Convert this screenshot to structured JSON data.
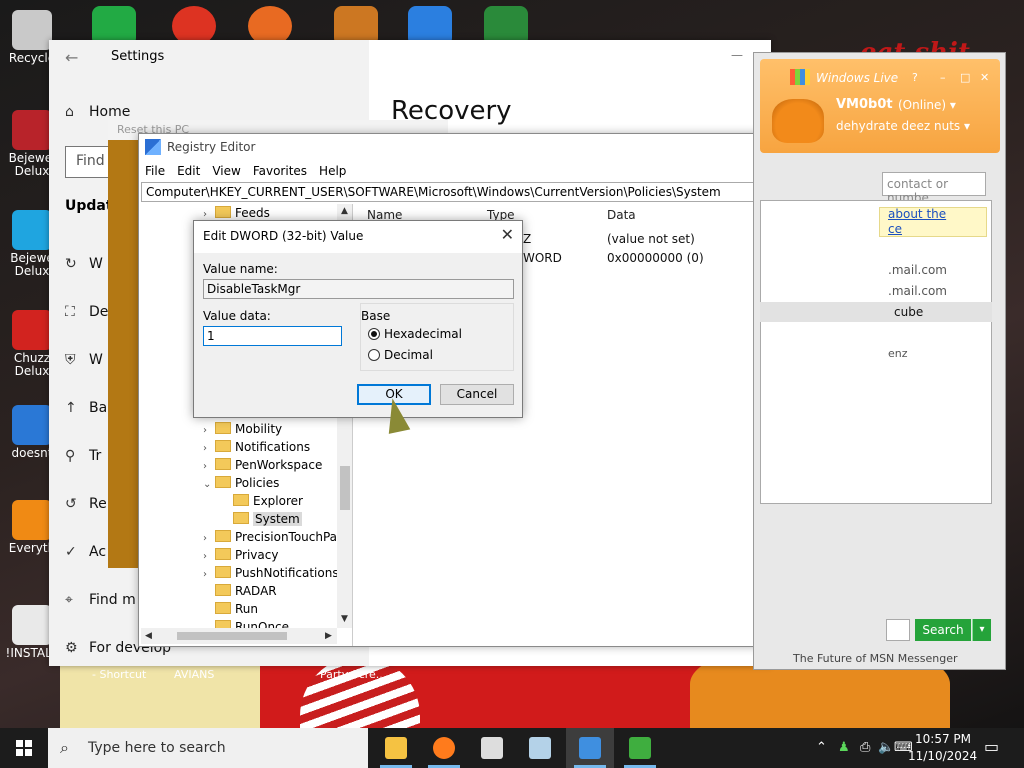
{
  "desktop": {
    "icons": [
      {
        "label": "Recycle",
        "color": "#c9c9c9"
      },
      {
        "label": "Bejewel Delux",
        "color": "#b8232a"
      },
      {
        "label": "Bejewe Delux",
        "color": "#1fa5e0"
      },
      {
        "label": "Chuzz Delux",
        "color": "#d2231f"
      },
      {
        "label": "doesnt",
        "color": "#2a78d6"
      },
      {
        "label": "Everyth",
        "color": "#f08a14"
      },
      {
        "label": "!INSTALL",
        "color": "#e9e9e9"
      }
    ],
    "shortcut_labels": [
      "- Shortcut",
      "AVIANS",
      "Party Scre..."
    ],
    "wallpaper_text": "eat shit"
  },
  "settings": {
    "title": "Settings",
    "back_glyph": "←",
    "min_glyph": "—",
    "nav": [
      {
        "icon": "⌂",
        "label": "Home"
      },
      {
        "icon": "↻",
        "label": "W"
      },
      {
        "icon": "⛶",
        "label": "De"
      },
      {
        "icon": "⛨",
        "label": "W"
      },
      {
        "icon": "↑",
        "label": "Ba"
      },
      {
        "icon": "⚲",
        "label": "Tr"
      },
      {
        "icon": "↺",
        "label": "Re"
      },
      {
        "icon": "✓",
        "label": "Ac"
      },
      {
        "icon": "⌖",
        "label": "Find m"
      },
      {
        "icon": "⚙",
        "label": "For develop"
      }
    ],
    "find_placeholder": "Find",
    "section": "Update",
    "page_title": "Recovery"
  },
  "reset_window": {
    "title": "Reset this PC"
  },
  "regedit": {
    "title": "Registry Editor",
    "menu": [
      "File",
      "Edit",
      "View",
      "Favorites",
      "Help"
    ],
    "address": "Computer\\HKEY_CURRENT_USER\\SOFTWARE\\Microsoft\\Windows\\CurrentVersion\\Policies\\System",
    "tree_top": [
      {
        "label": "Feeds",
        "arrow": "›"
      }
    ],
    "tree": [
      {
        "label": "Mobility",
        "arrow": "›"
      },
      {
        "label": "Notifications",
        "arrow": "›"
      },
      {
        "label": "PenWorkspace",
        "arrow": "›"
      },
      {
        "label": "Policies",
        "arrow": "⌄"
      },
      {
        "label": "Explorer",
        "arrow": ""
      },
      {
        "label": "System",
        "arrow": ""
      },
      {
        "label": "PrecisionTouchPad",
        "arrow": "›"
      },
      {
        "label": "Privacy",
        "arrow": "›"
      },
      {
        "label": "PushNotifications",
        "arrow": "›"
      },
      {
        "label": "RADAR",
        "arrow": ""
      },
      {
        "label": "Run",
        "arrow": ""
      },
      {
        "label": "RunOnce",
        "arrow": ""
      }
    ],
    "columns": [
      "Name",
      "Type",
      "Data"
    ],
    "rows": [
      {
        "type": "Z",
        "data": "(value not set)"
      },
      {
        "type": "WORD",
        "data": "0x00000000 (0)"
      }
    ],
    "scroll_glyphs": {
      "up": "▲",
      "down": "▼",
      "left": "◀",
      "right": "▶"
    }
  },
  "dword_dialog": {
    "title": "Edit DWORD (32-bit) Value",
    "close_glyph": "✕",
    "value_name_label": "Value name:",
    "value_name": "DisableTaskMgr",
    "value_data_label": "Value data:",
    "value_data": "1",
    "base_label": "Base",
    "hex_label": "Hexadecimal",
    "dec_label": "Decimal",
    "ok_label": "OK",
    "cancel_label": "Cancel"
  },
  "msn": {
    "title": "Windows Live",
    "controls": [
      "?",
      "–",
      "□",
      "✕"
    ],
    "user": "VM0b0t",
    "status": "(Online) ▾",
    "message": "dehydrate deez nuts ▾",
    "search_placeholder": "contact or numbe",
    "links": [
      "about the",
      "ce"
    ],
    "contacts": [
      ".mail.com",
      ".mail.com",
      "cube",
      "enz"
    ],
    "search_button": "Search",
    "footer": "The Future of MSN Messenger"
  },
  "taskbar": {
    "search_placeholder": "Type here to search",
    "search_glyph": "⌕",
    "tray_glyphs": [
      "⌃",
      "♟",
      "⎙",
      "🔈",
      "⌨"
    ],
    "time": "10:57 PM",
    "date": "11/10/2024",
    "notification_glyph": "▭",
    "apps": [
      {
        "name": "file-explorer",
        "color": "#f5c242"
      },
      {
        "name": "firefox",
        "color": "#ff7b1c"
      },
      {
        "name": "settings",
        "color": "#dddddd"
      },
      {
        "name": "control-panel",
        "color": "#b4d2e8"
      },
      {
        "name": "regedit",
        "color": "#3f8fe0"
      },
      {
        "name": "messenger",
        "color": "#3fae3f"
      }
    ]
  },
  "top_icons": [
    {
      "color": "#22aa44"
    },
    {
      "color": "#dd3322"
    },
    {
      "color": "#e86a22"
    },
    {
      "color": "#cc7722"
    },
    {
      "color": "#2b7fe0"
    },
    {
      "color": "#2a8a3a"
    }
  ]
}
